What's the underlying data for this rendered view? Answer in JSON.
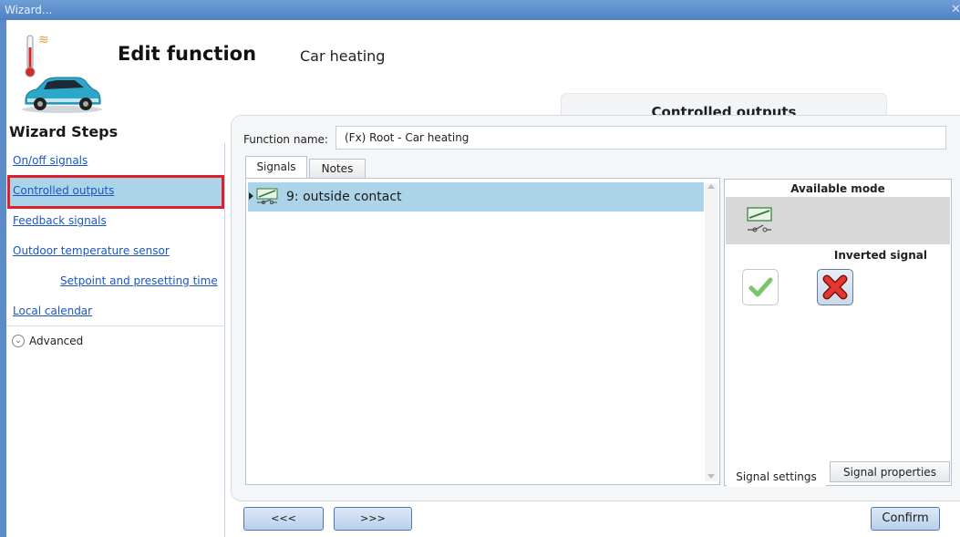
{
  "window": {
    "title": "Wizard...",
    "close_glyph": "✕"
  },
  "header": {
    "title": "Edit function",
    "subtitle": "Car heating",
    "tab_label": "Controlled outputs",
    "icons": [
      "thermometer-icon",
      "heat-waves-icon",
      "car-icon"
    ]
  },
  "wizard": {
    "heading": "Wizard Steps",
    "steps": [
      {
        "label": "On/off signals"
      },
      {
        "label": "Controlled outputs"
      },
      {
        "label": "Feedback signals"
      },
      {
        "label": "Outdoor temperature sensor"
      },
      {
        "label": "Setpoint and presetting time"
      },
      {
        "label": "Local calendar"
      }
    ],
    "active_step": "Controlled outputs",
    "advanced_label": "Advanced"
  },
  "function": {
    "name_label": "Function name:",
    "name_value": "(Fx) Root - Car heating"
  },
  "tabs": {
    "signals": "Signals",
    "notes": "Notes"
  },
  "signals": [
    {
      "label": "9: outside contact",
      "icon": "relay-switch-icon"
    }
  ],
  "side_panel": {
    "available_mode_heading": "Available mode",
    "inverted_signal_heading": "Inverted signal",
    "tab_signal_settings": "Signal settings",
    "tab_signal_properties": "Signal properties"
  },
  "buttons": {
    "prev": "<<<",
    "next": ">>>",
    "confirm": "Confirm"
  },
  "colors": {
    "selection": "#acd4e8",
    "highlight_border": "#d9222c",
    "titlebar": "#4f81c2"
  }
}
